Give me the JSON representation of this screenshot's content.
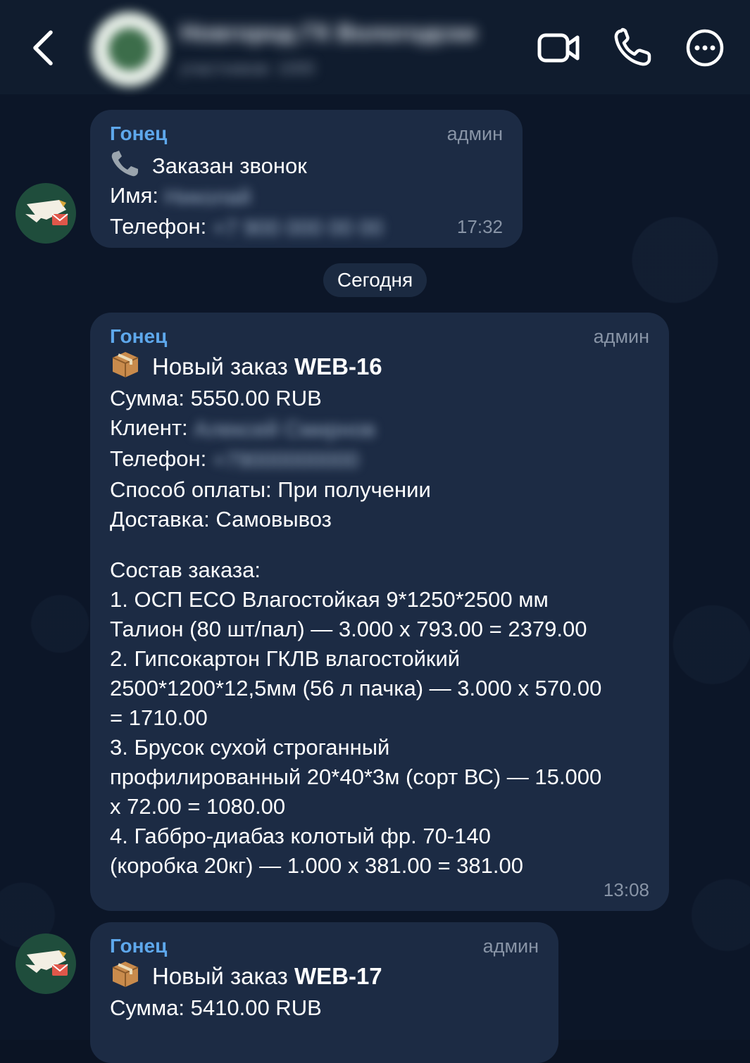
{
  "header": {
    "chat_title": "Новгород ГК Вологодский",
    "chat_subtitle": "участников: 1000",
    "icons": [
      "back-arrow-icon",
      "video-call-icon",
      "phone-icon",
      "more-options-icon"
    ]
  },
  "date_separator": "Сегодня",
  "messages": [
    {
      "sender": "Гонец",
      "role": "админ",
      "title": "Заказан звонок",
      "name_label": "Имя:",
      "name_value": "Николай",
      "phone_label": "Телефон:",
      "phone_value": "+7 900 000 00 00",
      "time": "17:32"
    },
    {
      "sender": "Гонец",
      "role": "админ",
      "title_prefix": "Новый заказ ",
      "title_id": "WEB-16",
      "sum": "Сумма: 5550.00 RUB",
      "client_label": "Клиент:",
      "client_value": "Алексей Смирнов",
      "phone_label": "Телефон:",
      "phone_value": "+79000000000",
      "payment": "Способ оплаты: При получении",
      "delivery": "Доставка: Самовывоз",
      "items_header": "Состав заказа:",
      "items_lines": [
        "1. ОСП ECO Влагостойкая 9*1250*2500 мм",
        "Талион (80 шт/пал) — 3.000 x 793.00 = 2379.00",
        "2. Гипсокартон ГКЛВ влагостойкий",
        "2500*1200*12,5мм (56 л пачка) — 3.000 x 570.00",
        "= 1710.00",
        "3. Брусок сухой строганный",
        "профилированный 20*40*3м (сорт ВС) — 15.000",
        "x 72.00 = 1080.00",
        "4. Габбро-диабаз колотый фр. 70-140",
        "(коробка 20кг) — 1.000 x 381.00 = 381.00"
      ],
      "time": "13:08"
    },
    {
      "sender": "Гонец",
      "role": "админ",
      "title_prefix": "Новый заказ ",
      "title_id": "WEB-17",
      "sum": "Сумма: 5410.00 RUB"
    }
  ],
  "colors": {
    "background": "#0c1628",
    "header": "#101c2e",
    "bubble": "#1c2b44",
    "sender": "#5ea8ec",
    "meta": "#8894a6"
  }
}
